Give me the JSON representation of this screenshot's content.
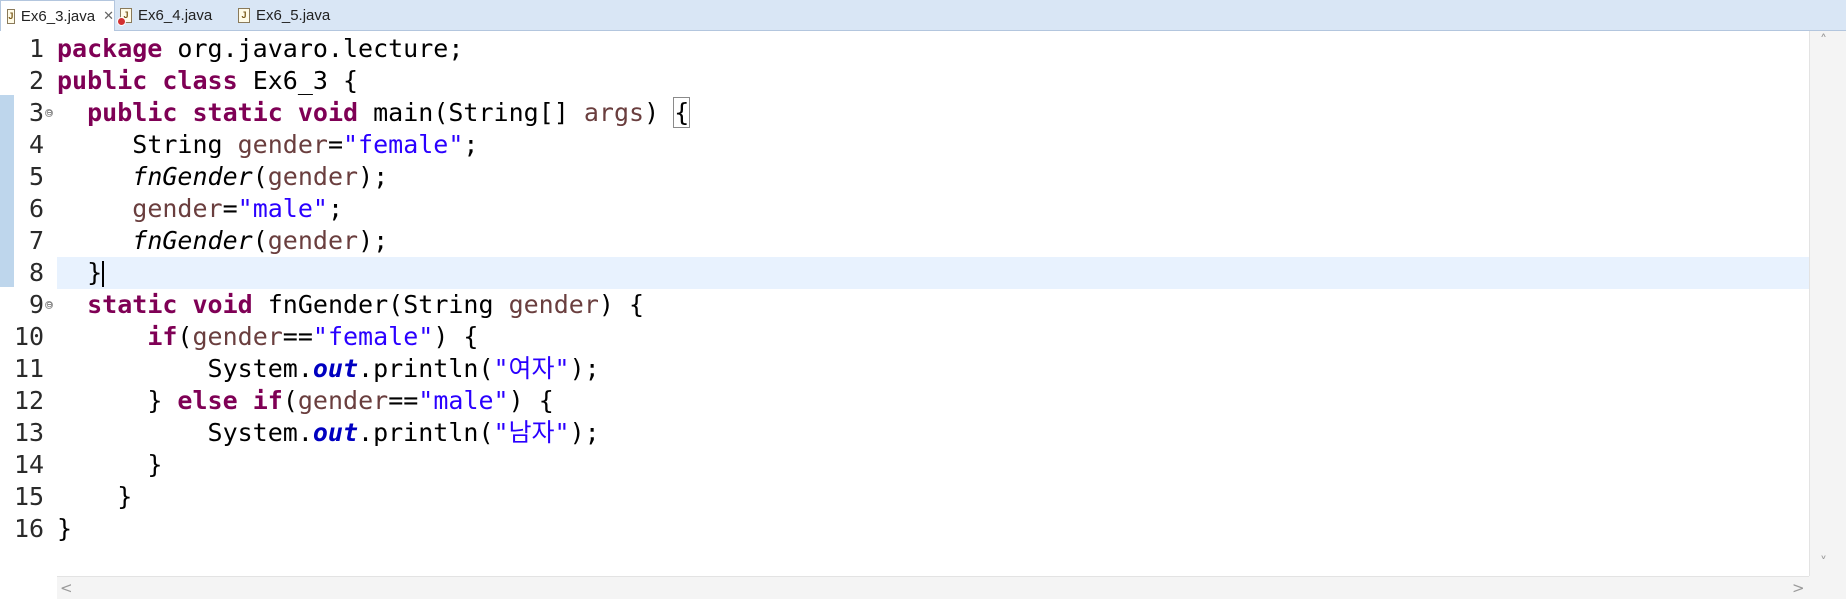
{
  "tabs": [
    {
      "label": "Ex6_3.java",
      "active": true,
      "close": "✕"
    },
    {
      "label": "Ex6_4.java",
      "active": false,
      "has_error": true
    },
    {
      "label": "Ex6_5.java",
      "active": false
    }
  ],
  "editor": {
    "current_line": 8,
    "line_numbers": [
      "1",
      "2",
      "3",
      "4",
      "5",
      "6",
      "7",
      "8",
      "9",
      "10",
      "11",
      "12",
      "13",
      "14",
      "15",
      "16"
    ],
    "fold_marker": "⊖",
    "code": {
      "l1": {
        "kw": "package",
        "rest": " org.javaro.lecture;"
      },
      "l2": {
        "kw1": "public",
        "kw2": "class",
        "rest": " Ex6_3 {"
      },
      "l3": {
        "kw1": "public",
        "kw2": "static",
        "kw3": "void",
        "name": " main(String[] ",
        "param": "args",
        "close": ") ",
        "brace": "{"
      },
      "l4": {
        "type": "String ",
        "var": "gender",
        "eq": "=",
        "str": "\"female\"",
        "end": ";"
      },
      "l5": {
        "method": "fnGender",
        "open": "(",
        "var": "gender",
        "end": ");"
      },
      "l6": {
        "var": "gender",
        "eq": "=",
        "str": "\"male\"",
        "end": ";"
      },
      "l7": {
        "method": "fnGender",
        "open": "(",
        "var": "gender",
        "end": ");"
      },
      "l8": {
        "brace": "}"
      },
      "l9": {
        "kw1": "static",
        "kw2": "void",
        "name": " fnGender(String ",
        "param": "gender",
        "end": ") {"
      },
      "l10": {
        "kw": "if",
        "open": "(",
        "var": "gender",
        "eq": "==",
        "str": "\"female\"",
        "end": ") {"
      },
      "l11": {
        "obj": "System.",
        "field": "out",
        "call": ".println(",
        "str": "\"여자\"",
        "end": ");"
      },
      "l12": {
        "pre": "} ",
        "kw1": "else",
        "kw2": "if",
        "open": "(",
        "var": "gender",
        "eq": "==",
        "str": "\"male\"",
        "end": ") {"
      },
      "l13": {
        "obj": "System.",
        "field": "out",
        "call": ".println(",
        "str": "\"남자\"",
        "end": ");"
      },
      "l14": {
        "brace": "}"
      },
      "l15": {
        "brace": "}"
      },
      "l16": {
        "brace": "}"
      }
    }
  },
  "scrollbar": {
    "up": "˄",
    "down": "˅",
    "left": "<",
    "right": ">"
  }
}
